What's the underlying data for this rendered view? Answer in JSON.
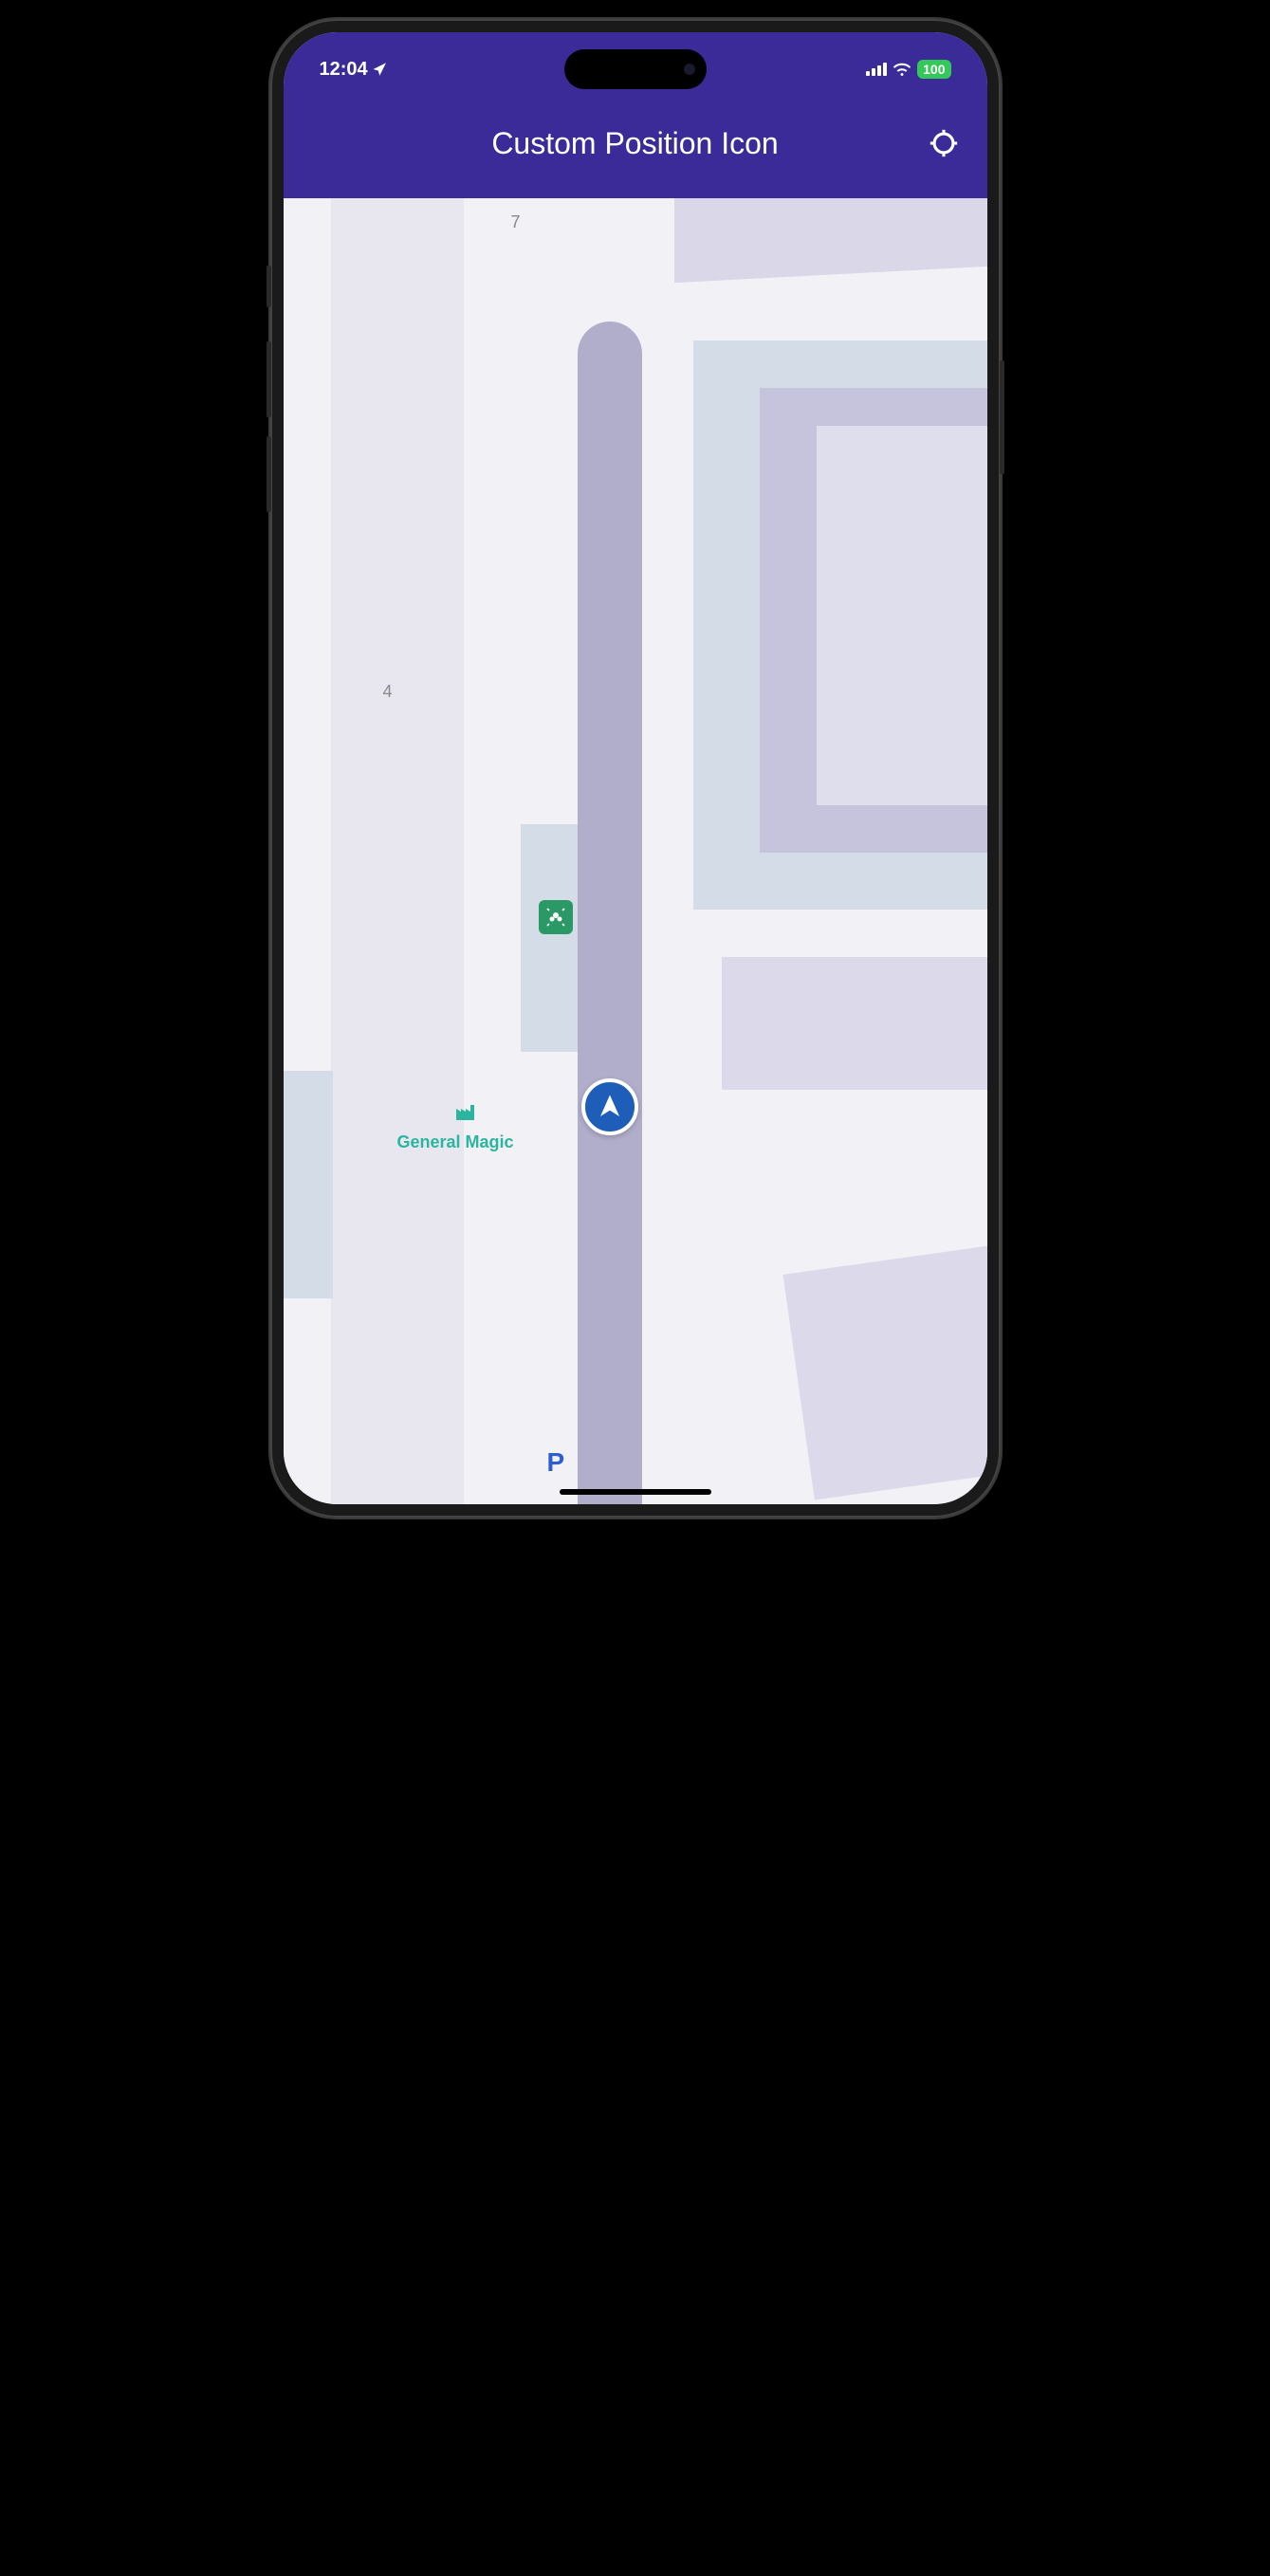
{
  "statusBar": {
    "time": "12:04",
    "battery": "100"
  },
  "header": {
    "title": "Custom Position Icon"
  },
  "map": {
    "numbers": {
      "n7": "7",
      "n4": "4"
    },
    "labels": {
      "generalMagic": "General Magic",
      "parking": "P"
    }
  }
}
